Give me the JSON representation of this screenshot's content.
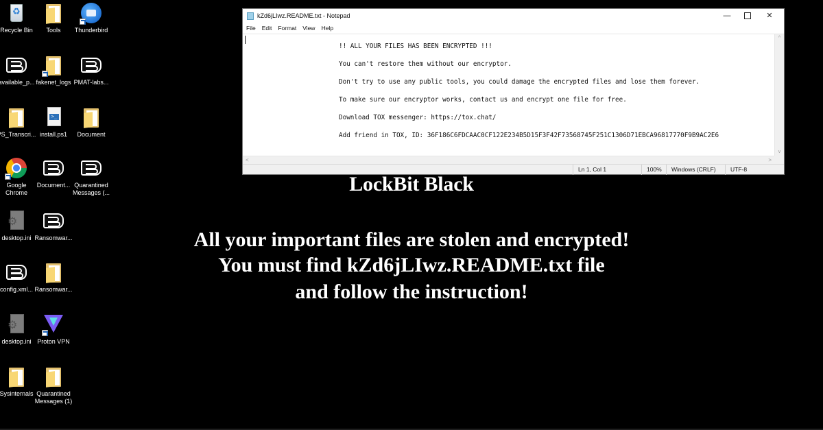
{
  "desktop": {
    "icons": [
      {
        "label": "Recycle Bin",
        "icon": "recycle-bin-icon"
      },
      {
        "label": "Tools",
        "icon": "folder-icon"
      },
      {
        "label": "Thunderbird",
        "icon": "thunderbird-icon"
      },
      {
        "label": "available_p...",
        "icon": "lockbit-icon"
      },
      {
        "label": "fakenet_logs",
        "icon": "folder-icon"
      },
      {
        "label": "PMAT-labs...",
        "icon": "lockbit-icon"
      },
      {
        "label": "PS_Transcri...",
        "icon": "folder-icon"
      },
      {
        "label": "install.ps1",
        "icon": "powershell-script-icon"
      },
      {
        "label": "Document",
        "icon": "folder-icon"
      },
      {
        "label": "Google Chrome",
        "icon": "chrome-icon"
      },
      {
        "label": "Document...",
        "icon": "lockbit-icon"
      },
      {
        "label": "Quarantined Messages (...",
        "icon": "lockbit-icon"
      },
      {
        "label": "desktop.ini",
        "icon": "settings-file-icon"
      },
      {
        "label": "Ransomwar...",
        "icon": "lockbit-icon"
      },
      {
        "label": "config.xml...",
        "icon": "lockbit-icon"
      },
      {
        "label": "Ransomwar...",
        "icon": "folder-icon"
      },
      {
        "label": "desktop.ini",
        "icon": "settings-file-icon"
      },
      {
        "label": "Proton VPN",
        "icon": "proton-vpn-icon"
      },
      {
        "label": "Sysinternals",
        "icon": "folder-icon"
      },
      {
        "label": "Quarantined Messages (1)",
        "icon": "folder-icon"
      }
    ]
  },
  "notepad": {
    "title": "kZd6jLIwz.README.txt - Notepad",
    "menu": [
      "File",
      "Edit",
      "Format",
      "View",
      "Help"
    ],
    "window_controls": {
      "minimize": "—",
      "close": "✕"
    },
    "lines": [
      "!! ALL YOUR FILES HAS BEEN ENCRYPTED !!!",
      "You can't restore them without our encryptor.",
      "Don't try to use any public tools, you could damage the encrypted files and lose them forever.",
      "To make sure our encryptor works, contact us and encrypt one file for free.",
      "Download TOX messenger: https://tox.chat/",
      "Add friend in TOX, ID: 36F186C6FDCAAC0CF122E234B5D15F3F42F73568745F251C1306D71EBCA96817770F9B9AC2E6"
    ],
    "scroll": {
      "up": "^",
      "down": "v",
      "left": "<",
      "right": ">"
    },
    "status": {
      "position": "Ln 1, Col 1",
      "zoom": "100%",
      "line_endings": "Windows (CRLF)",
      "encoding": "UTF-8"
    }
  },
  "wallpaper": {
    "title": "LockBit Black",
    "lines": [
      "All your important files are stolen and encrypted!",
      "You must find kZd6jLIwz.README.txt file",
      "and follow the instruction!"
    ]
  }
}
